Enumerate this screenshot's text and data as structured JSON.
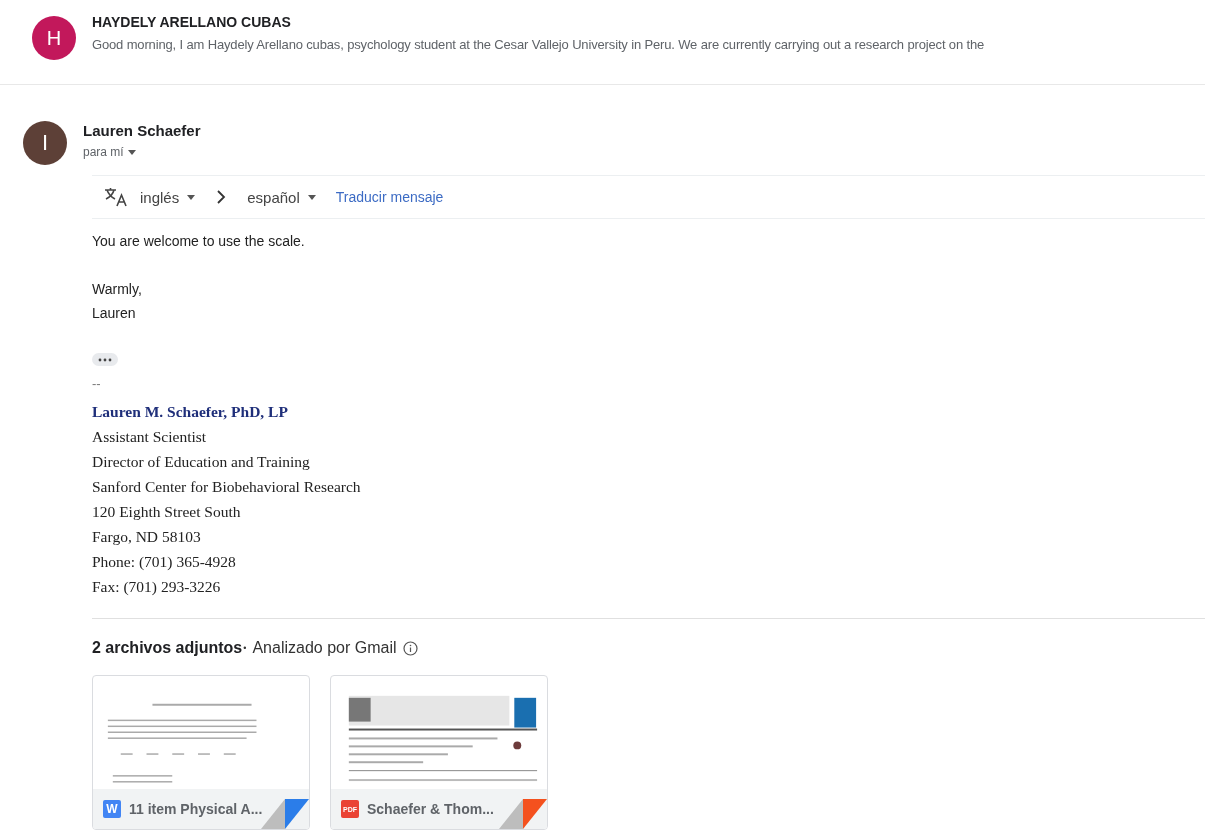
{
  "collapsed_message": {
    "avatar_letter": "H",
    "color": "#c2185b",
    "sender": "HAYDELY ARELLANO CUBAS",
    "snippet": "Good morning, I am Haydely Arellano cubas, psychology student at the Cesar Vallejo University in Peru. We are currently carrying out a research project on the"
  },
  "message": {
    "avatar_letter": "I",
    "color": "#5d4037",
    "sender": "Lauren Schaefer",
    "recipient": "para mí",
    "translate": {
      "from": "inglés",
      "to": "español",
      "action": "Traducir mensaje"
    },
    "body": [
      [
        "You are welcome to use the scale."
      ],
      [
        "Warmly,",
        "Lauren"
      ]
    ],
    "separator": "--",
    "signature": [
      {
        "text": "Lauren M. Schaefer, PhD, LP",
        "kind": "name"
      },
      {
        "text": "Assistant Scientist",
        "kind": "line"
      },
      {
        "text": "Director of Education and Training",
        "kind": "line"
      },
      {
        "text": "Sanford Center for Biobehavioral Research",
        "kind": "line"
      },
      {
        "text": "120 Eighth Street South",
        "kind": "line"
      },
      {
        "text": "Fargo, ND 58103",
        "kind": "line"
      },
      {
        "text": "Phone: (701) 365-4928",
        "kind": "line"
      },
      {
        "text": "Fax: (701) 293-3226",
        "kind": "line"
      }
    ],
    "attachments_header": {
      "count": "2 archivos adjuntos",
      "separator": "•",
      "scan_note": "Analizado por Gmail"
    },
    "attachments": [
      {
        "kind": "word",
        "badge": "W",
        "name": "11 item Physical A..."
      },
      {
        "kind": "pdf",
        "badge": "PDF",
        "name": "Schaefer & Thom..."
      }
    ]
  }
}
